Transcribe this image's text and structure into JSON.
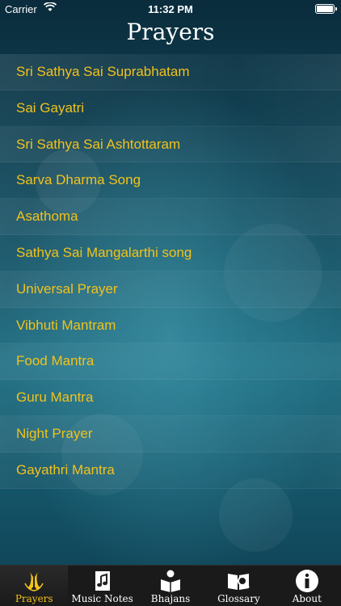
{
  "status": {
    "carrier": "Carrier",
    "time": "11:32 PM"
  },
  "header": {
    "title": "Prayers"
  },
  "prayers": [
    "Sri Sathya Sai Suprabhatam",
    "Sai Gayatri",
    "Sri Sathya Sai Ashtottaram",
    "Sarva Dharma Song",
    "Asathoma",
    "Sathya Sai Mangalarthi song",
    "Universal Prayer",
    "Vibhuti Mantram",
    "Food Mantra",
    "Guru Mantra",
    "Night Prayer",
    "Gayathri Mantra"
  ],
  "tabs": [
    {
      "label": "Prayers",
      "icon": "praying-hands-icon",
      "active": true
    },
    {
      "label": "Music Notes",
      "icon": "music-document-icon",
      "active": false
    },
    {
      "label": "Bhajans",
      "icon": "person-reading-icon",
      "active": false
    },
    {
      "label": "Glossary",
      "icon": "book-search-icon",
      "active": false
    },
    {
      "label": "About",
      "icon": "info-icon",
      "active": false
    }
  ],
  "colors": {
    "accent": "#f2c21a",
    "background": "#0b2f40"
  }
}
